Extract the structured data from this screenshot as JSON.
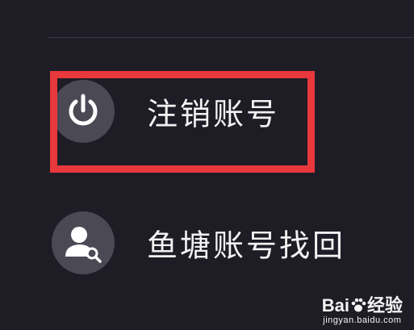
{
  "menu": {
    "items": [
      {
        "label": "注销账号",
        "icon": "power-icon"
      },
      {
        "label": "鱼塘账号找回",
        "icon": "user-search-icon"
      }
    ]
  },
  "highlight": {
    "color": "#e8383c",
    "target": "注销账号"
  },
  "watermark": {
    "logo_prefix": "Bai",
    "logo_suffix": "经验",
    "url": "jingyan.baidu.com"
  }
}
